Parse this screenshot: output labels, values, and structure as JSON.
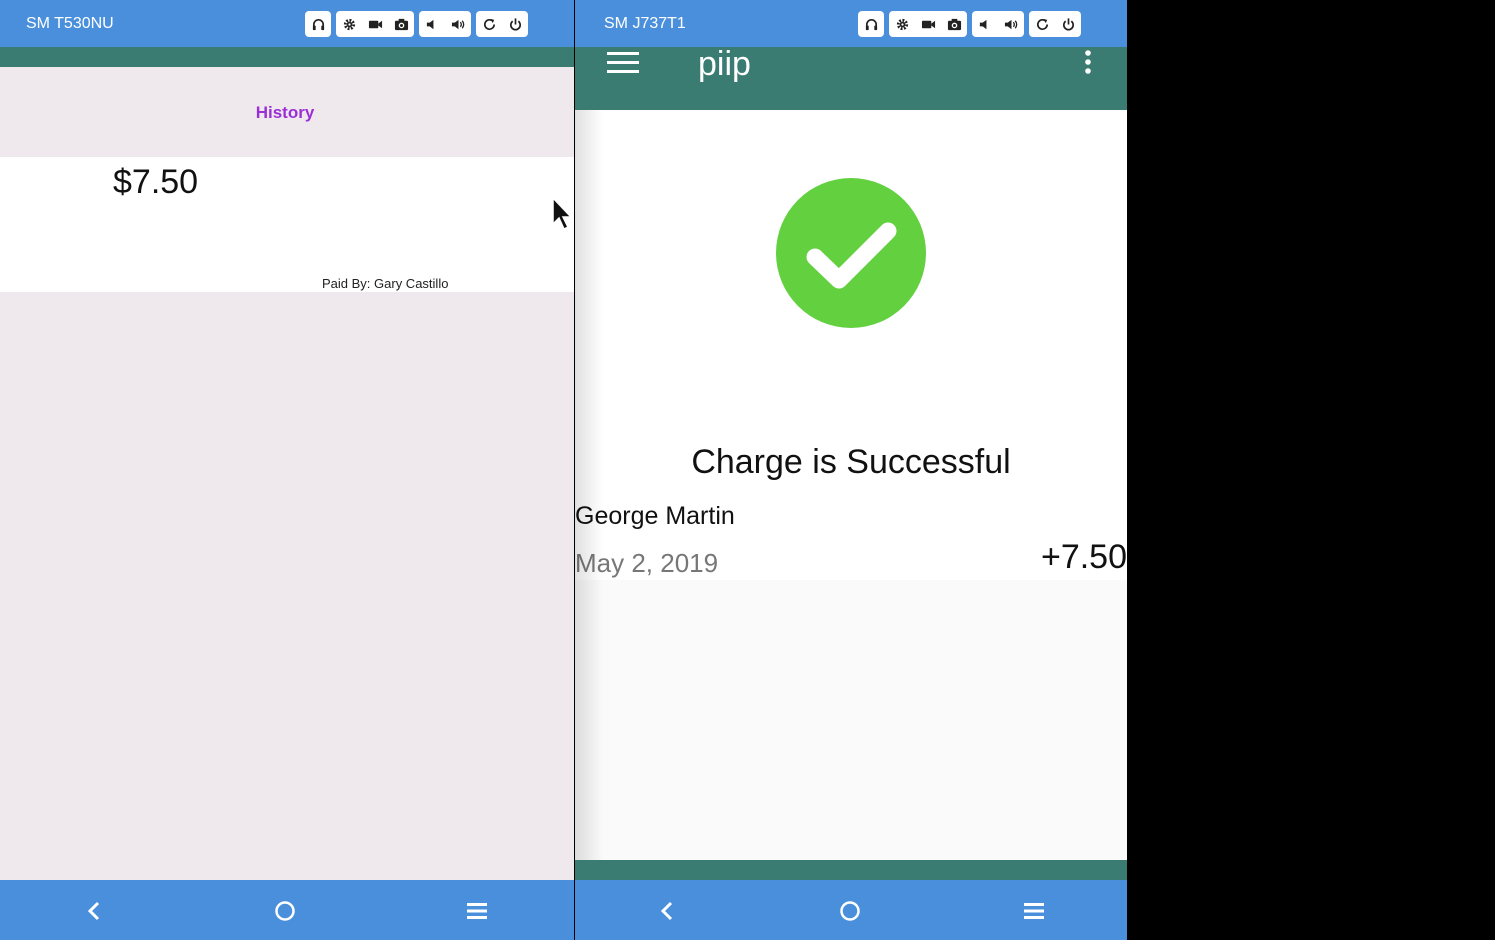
{
  "devices": [
    {
      "name": "SM T530NU"
    },
    {
      "name": "SM J737T1"
    }
  ],
  "history": {
    "title": "History",
    "amount": "$7.50",
    "paid_by": "Paid By: Gary Castillo"
  },
  "charge": {
    "app_title": "piip",
    "status": "Charge is Successful",
    "payer": "George Martin",
    "date": "May 2, 2019",
    "amount": "+7.50"
  },
  "colors": {
    "device_bar": "#4a8fdc",
    "app_bar": "#3a7b72",
    "history_title": "#9b2fd6",
    "success_green": "#62d03f"
  }
}
